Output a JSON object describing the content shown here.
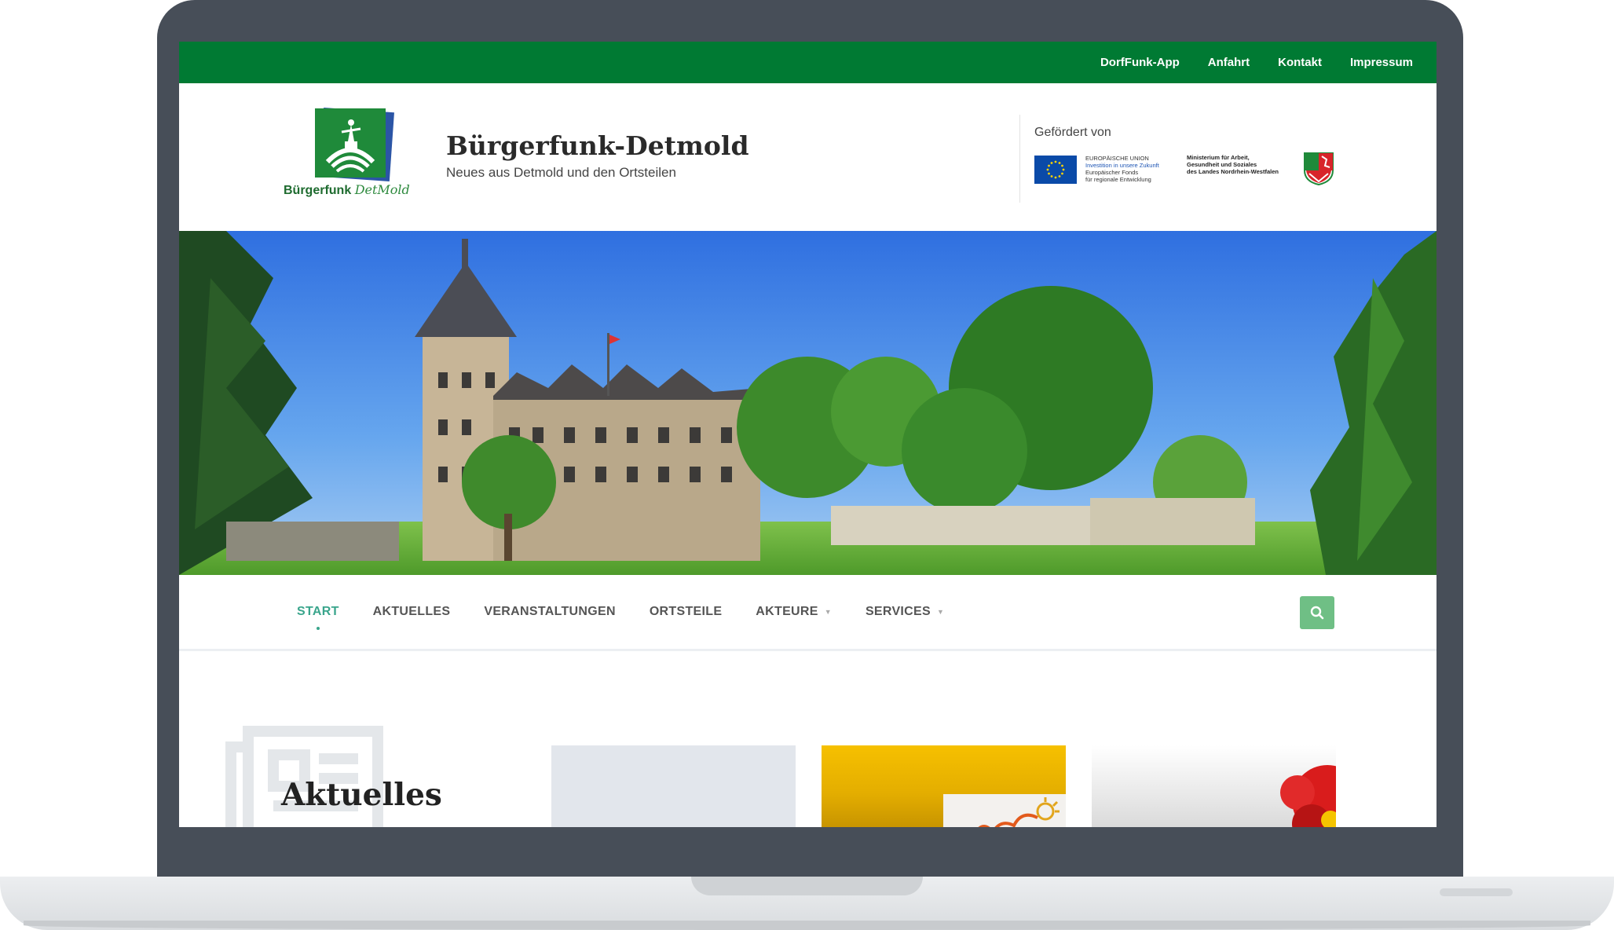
{
  "topbar": {
    "links": [
      "DorfFunk-App",
      "Anfahrt",
      "Kontakt",
      "Impressum"
    ]
  },
  "header": {
    "logo_text": "Bürgerfunk",
    "logo_script": "DetMold",
    "title": "Bürgerfunk-Detmold",
    "subtitle": "Neues aus Detmold und den Ortsteilen",
    "funded_by": "Gefördert von",
    "eu_line1": "EUROPÄISCHE UNION",
    "eu_line2": "Investition in unsere Zukunft",
    "eu_line3": "Europäischer Fonds",
    "eu_line4": "für regionale Entwicklung",
    "nrw_line1": "Ministerium für Arbeit,",
    "nrw_line2": "Gesundheit und Soziales",
    "nrw_line3": "des Landes Nordrhein-Westfalen"
  },
  "nav": {
    "items": [
      {
        "label": "START",
        "active": true,
        "dropdown": false
      },
      {
        "label": "AKTUELLES",
        "active": false,
        "dropdown": false
      },
      {
        "label": "VERANSTALTUNGEN",
        "active": false,
        "dropdown": false
      },
      {
        "label": "ORTSTEILE",
        "active": false,
        "dropdown": false
      },
      {
        "label": "AKTEURE",
        "active": false,
        "dropdown": true
      },
      {
        "label": "SERVICES",
        "active": false,
        "dropdown": true
      }
    ],
    "search_icon": "search-icon"
  },
  "content": {
    "section_title": "Aktuelles",
    "section_icon": "newspaper-icon"
  },
  "colors": {
    "brand_green": "#007a33",
    "accent_teal": "#3aa58c",
    "search_green": "#6fbf85",
    "frame": "#474e58"
  }
}
